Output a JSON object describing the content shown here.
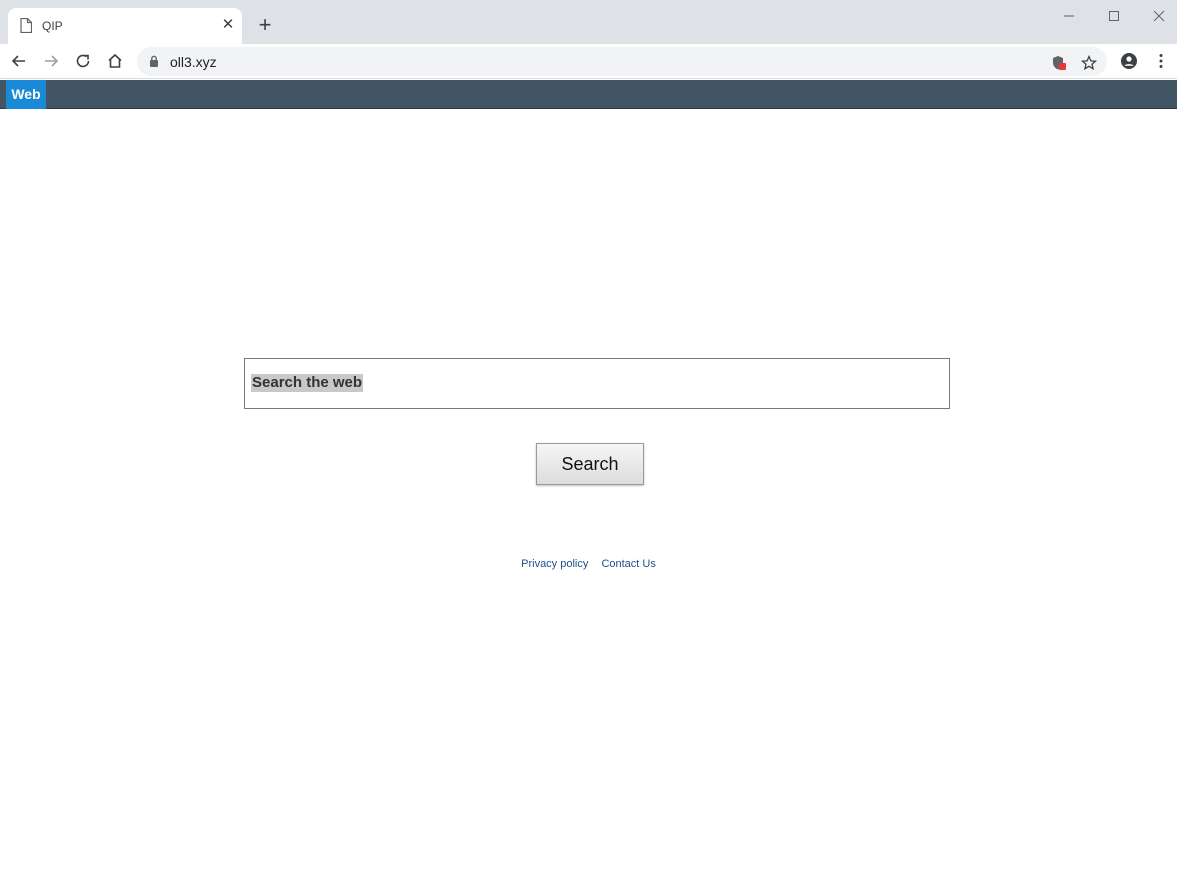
{
  "browser": {
    "tab_title": "QIP",
    "url": "oll3.xyz"
  },
  "sitebar": {
    "web_label": "Web"
  },
  "search": {
    "placeholder": "Search the web",
    "button_label": "Search"
  },
  "footer": {
    "privacy_label": "Privacy policy",
    "contact_label": "Contact Us"
  },
  "colors": {
    "sitebar": "#425563",
    "web_tab": "#1a8ad6",
    "link": "#1f4f8a"
  },
  "icons": [
    "page-icon",
    "close-icon",
    "plus-icon",
    "minimize-icon",
    "maximize-icon",
    "window-close-icon",
    "back-arrow-icon",
    "forward-arrow-icon",
    "reload-icon",
    "home-icon",
    "lock-icon",
    "shield-extension-icon",
    "star-icon",
    "account-icon",
    "kebab-menu-icon"
  ]
}
